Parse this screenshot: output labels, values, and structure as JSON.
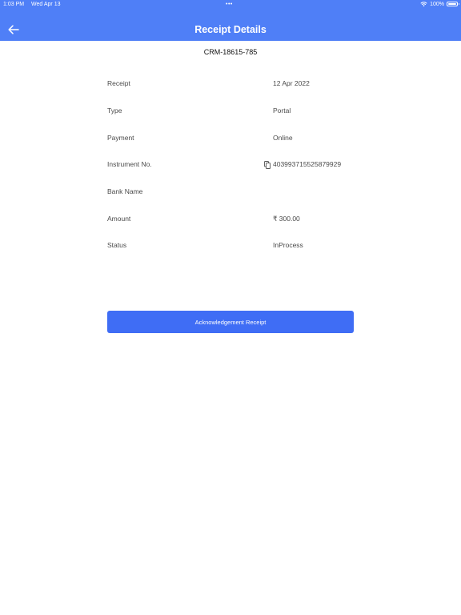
{
  "status_bar": {
    "time": "1:03 PM",
    "date": "Wed Apr 13",
    "dots": "•••",
    "battery": "100%"
  },
  "header": {
    "title": "Receipt Details",
    "back_icon": "arrow-left-icon"
  },
  "reference": "CRM-18615-785",
  "details": [
    {
      "label": "Receipt",
      "value": "12 Apr 2022"
    },
    {
      "label": "Type",
      "value": "Portal"
    },
    {
      "label": "Payment",
      "value": "Online"
    },
    {
      "label": "Instrument No.",
      "value": "403993715525879929"
    },
    {
      "label": "Bank Name",
      "value": ""
    },
    {
      "label": "Amount",
      "value": "₹ 300.00"
    },
    {
      "label": "Status",
      "value": "InProcess"
    }
  ],
  "actions": {
    "acknowledgement_label": "Acknowledgement Receipt"
  },
  "colors": {
    "header": "#4f7ff7",
    "button": "#3f6df5"
  }
}
